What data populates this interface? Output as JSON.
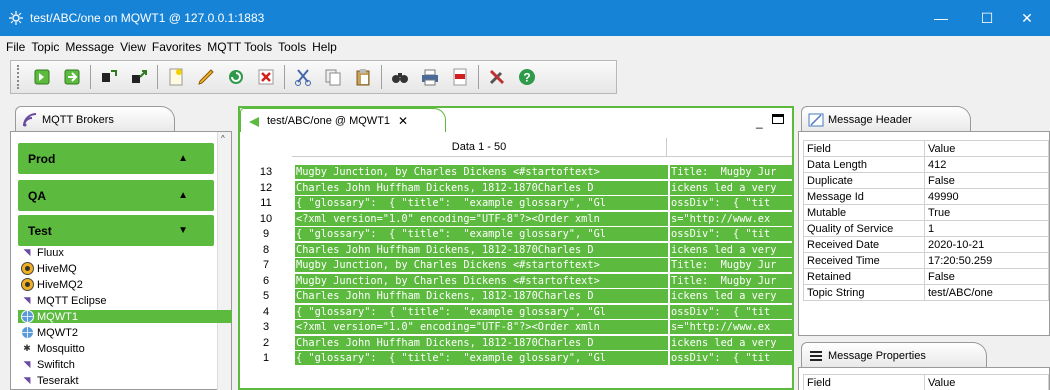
{
  "window": {
    "title": "test/ABC/one on MQWT1 @ 127.0.0.1:1883",
    "minimize": "—",
    "maximize": "☐",
    "close": "✕"
  },
  "menu": [
    "File",
    "Topic",
    "Message",
    "View",
    "Favorites",
    "MQTT Tools",
    "Tools",
    "Help"
  ],
  "brokers_panel": {
    "tab_label": "MQTT Brokers",
    "groups": [
      {
        "name": "Prod",
        "arrow": "▲"
      },
      {
        "name": "QA",
        "arrow": "▲"
      },
      {
        "name": "Test",
        "arrow": "▼"
      }
    ],
    "brokers": [
      {
        "name": "Fluux",
        "icon": "broker-icon"
      },
      {
        "name": "HiveMQ",
        "icon": "hivemq-icon"
      },
      {
        "name": "HiveMQ2",
        "icon": "hivemq-icon"
      },
      {
        "name": "MQTT Eclipse",
        "icon": "broker-icon"
      },
      {
        "name": "MQWT1",
        "icon": "globe-icon"
      },
      {
        "name": "MQWT2",
        "icon": "globe-icon"
      },
      {
        "name": "Mosquitto",
        "icon": "mosquito-icon"
      },
      {
        "name": "Swifitch",
        "icon": "broker-icon"
      },
      {
        "name": "Teserakt",
        "icon": "broker-icon"
      }
    ]
  },
  "topic_panel": {
    "tab_label": "test/ABC/one @ MQWT1",
    "column_header": "Data 1 - 50",
    "rows": [
      {
        "num": "13",
        "c1": "Mugby Junction, by Charles Dickens <#startoftext> ",
        "c2": "Title:  Mugby Jur"
      },
      {
        "num": "12",
        "c1": "Charles John Huffham Dickens, 1812-1870Charles D ",
        "c2": "ickens led a very"
      },
      {
        "num": "11",
        "c1": "{ \"glossary\":  { \"title\":  \"example glossary\", \"Gl ",
        "c2": "ossDiv\":  { \"tit"
      },
      {
        "num": "10",
        "c1": "<?xml version=\"1.0\" encoding=\"UTF-8\"?><Order xmln ",
        "c2": "s=\"http://www.ex"
      },
      {
        "num": "9",
        "c1": "{ \"glossary\":  { \"title\":  \"example glossary\", \"Gl ",
        "c2": "ossDiv\":  { \"tit"
      },
      {
        "num": "8",
        "c1": "Charles John Huffham Dickens, 1812-1870Charles D ",
        "c2": "ickens led a very"
      },
      {
        "num": "7",
        "c1": "Mugby Junction, by Charles Dickens <#startoftext> ",
        "c2": "Title:  Mugby Jur"
      },
      {
        "num": "6",
        "c1": "Mugby Junction, by Charles Dickens <#startoftext> ",
        "c2": "Title:  Mugby Jur"
      },
      {
        "num": "5",
        "c1": "Charles John Huffham Dickens, 1812-1870Charles D ",
        "c2": "ickens led a very"
      },
      {
        "num": "4",
        "c1": "{ \"glossary\":  { \"title\":  \"example glossary\", \"Gl ",
        "c2": "ossDiv\":  { \"tit"
      },
      {
        "num": "3",
        "c1": "<?xml version=\"1.0\" encoding=\"UTF-8\"?><Order xmln ",
        "c2": "s=\"http://www.ex"
      },
      {
        "num": "2",
        "c1": "Charles John Huffham Dickens, 1812-1870Charles D ",
        "c2": "ickens led a very"
      },
      {
        "num": "1",
        "c1": "{ \"glossary\":  { \"title\":  \"example glossary\", \"Gl ",
        "c2": "ossDiv\":  { \"tit"
      }
    ]
  },
  "header_panel": {
    "tab_label": "Message Header",
    "col_field": "Field",
    "col_value": "Value",
    "rows": [
      {
        "field": "Data Length",
        "value": "412"
      },
      {
        "field": "Duplicate",
        "value": "False"
      },
      {
        "field": "Message Id",
        "value": "49990"
      },
      {
        "field": "Mutable",
        "value": "True"
      },
      {
        "field": "Quality of Service",
        "value": "1"
      },
      {
        "field": "Received Date",
        "value": "2020-10-21"
      },
      {
        "field": "Received Time",
        "value": "17:20:50.259"
      },
      {
        "field": "Retained",
        "value": "False"
      },
      {
        "field": "Topic String",
        "value": "test/ABC/one"
      }
    ]
  },
  "properties_panel": {
    "tab_label": "Message Properties",
    "col_field": "Field",
    "col_value": "Value"
  },
  "colors": {
    "titlebar": "#1783d6",
    "accent_green": "#5cba3e"
  }
}
